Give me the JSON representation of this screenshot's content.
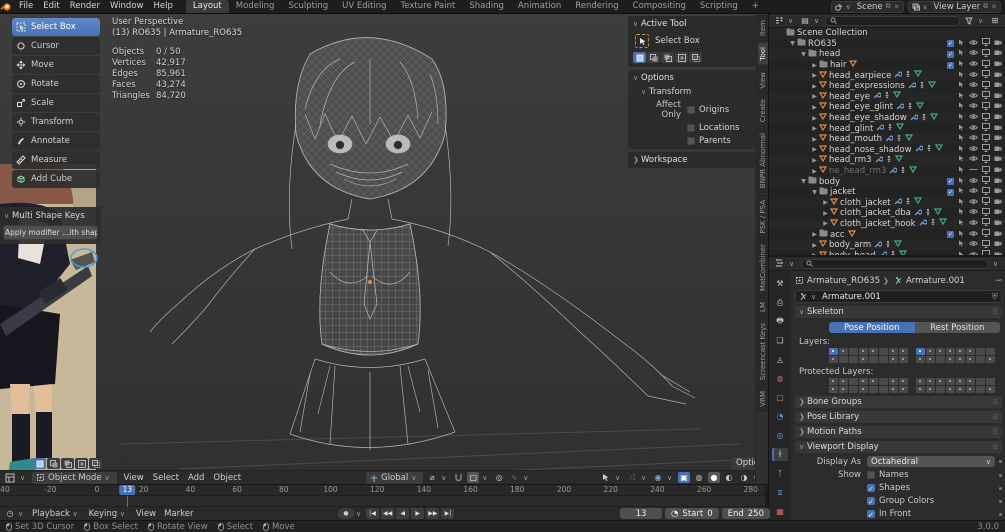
{
  "topbar": {
    "menus": [
      "File",
      "Edit",
      "Render",
      "Window",
      "Help"
    ],
    "tabs": [
      "Layout",
      "Modeling",
      "Sculpting",
      "UV Editing",
      "Texture Paint",
      "Shading",
      "Animation",
      "Rendering",
      "Compositing",
      "Scripting"
    ],
    "active_tab": "Layout",
    "add_tab": "+",
    "scene_name": "Scene",
    "view_layer_name": "View Layer"
  },
  "toolbar": {
    "tools": [
      {
        "name": "select-box",
        "label": "Select Box",
        "active": true
      },
      {
        "name": "cursor",
        "label": "Cursor",
        "active": false
      },
      {
        "name": "move",
        "label": "Move",
        "active": false
      },
      {
        "name": "rotate",
        "label": "Rotate",
        "active": false
      },
      {
        "name": "scale",
        "label": "Scale",
        "active": false
      },
      {
        "name": "transform",
        "label": "Transform",
        "active": false
      },
      {
        "name": "annotate",
        "label": "Annotate",
        "active": false
      },
      {
        "name": "measure",
        "label": "Measure",
        "active": false
      },
      {
        "name": "add-cube",
        "label": "Add Cube",
        "active": false
      }
    ],
    "shape_keys_panel": {
      "title": "Multi Shape Keys",
      "button_label": "Apply modifier ...ith shape keys"
    }
  },
  "viewport": {
    "view_label": "User Perspective",
    "context_label": "(13) RO635 | Armature_RO635",
    "stats": [
      {
        "label": "Objects",
        "value": "0 / 50"
      },
      {
        "label": "Vertices",
        "value": "42,917"
      },
      {
        "label": "Edges",
        "value": "85,961"
      },
      {
        "label": "Faces",
        "value": "43,274"
      },
      {
        "label": "Triangles",
        "value": "84,720"
      }
    ],
    "header": {
      "mode": "Object Mode",
      "menus": [
        "View",
        "Select",
        "Add",
        "Object"
      ],
      "orientation": "Global",
      "options_label": "Options"
    }
  },
  "npanel": {
    "tabs": [
      "Item",
      "Tool",
      "View",
      "Create",
      "BNPR Abnormal",
      "PSK / PSA",
      "MatCombiner",
      "LM",
      "Screencast Keys",
      "VRM"
    ],
    "active_tab": "Tool",
    "active_tool_title": "Active Tool",
    "tool_name": "Select Box",
    "mode_icons": [
      "set",
      "extend",
      "subtract",
      "invert",
      "intersect"
    ],
    "options_title": "Options",
    "transform_title": "Transform",
    "affect_only_label": "Affect Only",
    "affect_checkboxes": [
      {
        "label": "Origins",
        "checked": false
      },
      {
        "label": "Locations",
        "checked": false
      },
      {
        "label": "Parents",
        "checked": false
      }
    ],
    "workspace_title": "Workspace"
  },
  "outliner": {
    "rows": [
      {
        "name": "Scene Collection",
        "type": "scene",
        "depth": 0,
        "exp": "none",
        "check": false,
        "dim": false,
        "mods": false,
        "badge": false
      },
      {
        "name": "RO635",
        "type": "collection",
        "depth": 1,
        "exp": "open",
        "check": true,
        "dim": false,
        "mods": false,
        "badge": false
      },
      {
        "name": "head",
        "type": "collection",
        "depth": 2,
        "exp": "open",
        "check": true,
        "dim": false,
        "mods": false,
        "badge": false
      },
      {
        "name": "hair",
        "type": "collection",
        "depth": 3,
        "exp": "closed",
        "check": true,
        "dim": false,
        "mods": false,
        "badge": true
      },
      {
        "name": "head_earpiece",
        "type": "mesh",
        "depth": 3,
        "exp": "closed",
        "check": false,
        "dim": false,
        "mods": true,
        "badge": false
      },
      {
        "name": "head_expressions",
        "type": "mesh",
        "depth": 3,
        "exp": "closed",
        "check": false,
        "dim": false,
        "mods": true,
        "badge": false
      },
      {
        "name": "head_eye",
        "type": "mesh",
        "depth": 3,
        "exp": "closed",
        "check": false,
        "dim": false,
        "mods": true,
        "badge": false
      },
      {
        "name": "head_eye_glint",
        "type": "mesh",
        "depth": 3,
        "exp": "closed",
        "check": false,
        "dim": false,
        "mods": true,
        "badge": false
      },
      {
        "name": "head_eye_shadow",
        "type": "mesh",
        "depth": 3,
        "exp": "closed",
        "check": false,
        "dim": false,
        "mods": true,
        "badge": false
      },
      {
        "name": "head_glint",
        "type": "mesh",
        "depth": 3,
        "exp": "closed",
        "check": false,
        "dim": false,
        "mods": true,
        "badge": false
      },
      {
        "name": "head_mouth",
        "type": "mesh",
        "depth": 3,
        "exp": "closed",
        "check": false,
        "dim": false,
        "mods": true,
        "badge": false
      },
      {
        "name": "head_nose_shadow",
        "type": "mesh",
        "depth": 3,
        "exp": "closed",
        "check": false,
        "dim": false,
        "mods": true,
        "badge": false
      },
      {
        "name": "head_rm3",
        "type": "mesh",
        "depth": 3,
        "exp": "closed",
        "check": false,
        "dim": false,
        "mods": true,
        "badge": false
      },
      {
        "name": "ne_head_rm3",
        "type": "mesh",
        "depth": 3,
        "exp": "closed",
        "check": false,
        "dim": true,
        "mods": true,
        "badge": false
      },
      {
        "name": "body",
        "type": "collection",
        "depth": 2,
        "exp": "open",
        "check": true,
        "dim": false,
        "mods": false,
        "badge": false
      },
      {
        "name": "jacket",
        "type": "collection",
        "depth": 3,
        "exp": "open",
        "check": true,
        "dim": false,
        "mods": false,
        "badge": false
      },
      {
        "name": "cloth_jacket",
        "type": "mesh",
        "depth": 4,
        "exp": "closed",
        "check": false,
        "dim": false,
        "mods": true,
        "badge": false
      },
      {
        "name": "cloth_jacket_dba",
        "type": "mesh",
        "depth": 4,
        "exp": "closed",
        "check": false,
        "dim": false,
        "mods": true,
        "badge": false
      },
      {
        "name": "cloth_jacket_hook",
        "type": "mesh",
        "depth": 4,
        "exp": "closed",
        "check": false,
        "dim": false,
        "mods": true,
        "badge": false
      },
      {
        "name": "acc",
        "type": "collection",
        "depth": 3,
        "exp": "closed",
        "check": true,
        "dim": false,
        "mods": false,
        "badge": true
      },
      {
        "name": "body_arm",
        "type": "mesh",
        "depth": 3,
        "exp": "closed",
        "check": false,
        "dim": false,
        "mods": true,
        "badge": false
      },
      {
        "name": "body_head",
        "type": "mesh",
        "depth": 3,
        "exp": "closed",
        "check": false,
        "dim": false,
        "mods": true,
        "badge": false
      }
    ]
  },
  "properties": {
    "breadcrumb": {
      "object": "Armature_RO635",
      "data": "Armature.001"
    },
    "datablock_name": "Armature.001",
    "skeleton": {
      "title": "Skeleton",
      "pose_button": "Pose Position",
      "rest_button": "Rest Position",
      "layers_label": "Layers:",
      "protected_label": "Protected Layers:",
      "layers": [
        [
          2,
          1,
          0,
          1,
          1,
          0,
          1,
          1
        ],
        [
          1,
          0,
          0,
          1,
          0,
          0,
          1,
          1
        ],
        [
          2,
          1,
          1,
          1,
          1,
          1,
          0,
          0
        ],
        [
          1,
          1,
          0,
          1,
          1,
          1,
          0,
          1
        ]
      ],
      "protected_layers": [
        [
          1,
          1,
          0,
          1,
          1,
          0,
          1,
          1
        ],
        [
          1,
          1,
          0,
          1,
          0,
          0,
          1,
          1
        ],
        [
          1,
          1,
          1,
          1,
          1,
          1,
          0,
          0
        ],
        [
          1,
          1,
          0,
          1,
          1,
          1,
          0,
          1
        ]
      ]
    },
    "collapsed_panels": [
      "Bone Groups",
      "Pose Library",
      "Motion Paths"
    ],
    "viewport_display": {
      "title": "Viewport Display",
      "display_as_label": "Display As",
      "display_as_value": "Octahedral",
      "show_label": "Show",
      "toggles": [
        {
          "label": "Names",
          "checked": false
        },
        {
          "label": "Shapes",
          "checked": true
        },
        {
          "label": "Group Colors",
          "checked": true
        },
        {
          "label": "In Front",
          "checked": true
        }
      ]
    },
    "tab_icons": [
      "tool",
      "render",
      "output",
      "view-layer",
      "scene",
      "world",
      "object",
      "modifiers",
      "physics",
      "object-data",
      "bone",
      "bone-constraints",
      "texture"
    ],
    "active_tab_icon": "object-data"
  },
  "timeline": {
    "menus": [
      "Playback",
      "Keying",
      "View",
      "Marker"
    ],
    "ticks": [
      -40,
      -20,
      0,
      20,
      40,
      60,
      80,
      100,
      120,
      140,
      160,
      180,
      200,
      220,
      240,
      260,
      280
    ],
    "current_frame": "13",
    "frame_field_value": "13",
    "start_label": "Start",
    "start_value": "0",
    "end_label": "End",
    "end_value": "250"
  },
  "statusbar": {
    "hints": [
      "Set 3D Cursor",
      "Box Select",
      "Rotate View",
      "Select",
      "Move"
    ],
    "version": "3.0.0"
  },
  "colors": {
    "accent": "#4772b3",
    "mesh_orange": "#e58845",
    "data_green": "#3fae7c",
    "modifier_blue": "#6b9fd4"
  }
}
